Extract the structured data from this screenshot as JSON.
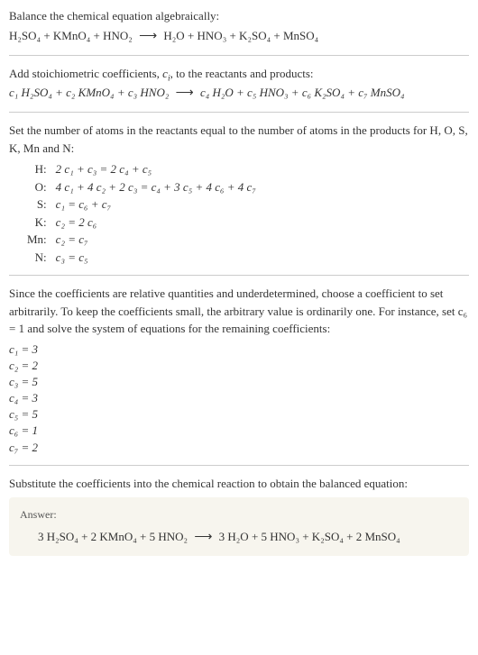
{
  "intro": {
    "title": "Balance the chemical equation algebraically:",
    "eq_lhs": "H₂SO₄ + KMnO₄ + HNO₂",
    "eq_rhs": "H₂O + HNO₃ + K₂SO₄ + MnSO₄"
  },
  "step_coeff": {
    "text_before": "Add stoichiometric coefficients, ",
    "ci": "c",
    "ci_sub": "i",
    "text_after": ", to the reactants and products:",
    "eq_lhs": "c₁ H₂SO₄ + c₂ KMnO₄ + c₃ HNO₂",
    "eq_rhs": "c₄ H₂O + c₅ HNO₃ + c₆ K₂SO₄ + c₇ MnSO₄"
  },
  "atoms": {
    "intro": "Set the number of atoms in the reactants equal to the number of atoms in the products for H, O, S, K, Mn and N:",
    "rows": [
      {
        "el": "H:",
        "eq": "2 c₁ + c₃ = 2 c₄ + c₅"
      },
      {
        "el": "O:",
        "eq": "4 c₁ + 4 c₂ + 2 c₃ = c₄ + 3 c₅ + 4 c₆ + 4 c₇"
      },
      {
        "el": "S:",
        "eq": "c₁ = c₆ + c₇"
      },
      {
        "el": "K:",
        "eq": "c₂ = 2 c₆"
      },
      {
        "el": "Mn:",
        "eq": "c₂ = c₇"
      },
      {
        "el": "N:",
        "eq": "c₃ = c₅"
      }
    ]
  },
  "solve": {
    "intro": "Since the coefficients are relative quantities and underdetermined, choose a coefficient to set arbitrarily. To keep the coefficients small, the arbitrary value is ordinarily one. For instance, set c₆ = 1 and solve the system of equations for the remaining coefficients:",
    "vals": [
      "c₁ = 3",
      "c₂ = 2",
      "c₃ = 5",
      "c₄ = 3",
      "c₅ = 5",
      "c₆ = 1",
      "c₇ = 2"
    ]
  },
  "final": {
    "intro": "Substitute the coefficients into the chemical reaction to obtain the balanced equation:",
    "answer_label": "Answer:",
    "eq_lhs": "3 H₂SO₄ + 2 KMnO₄ + 5 HNO₂",
    "eq_rhs": "3 H₂O + 5 HNO₃ + K₂SO₄ + 2 MnSO₄"
  },
  "arrow": "⟶"
}
